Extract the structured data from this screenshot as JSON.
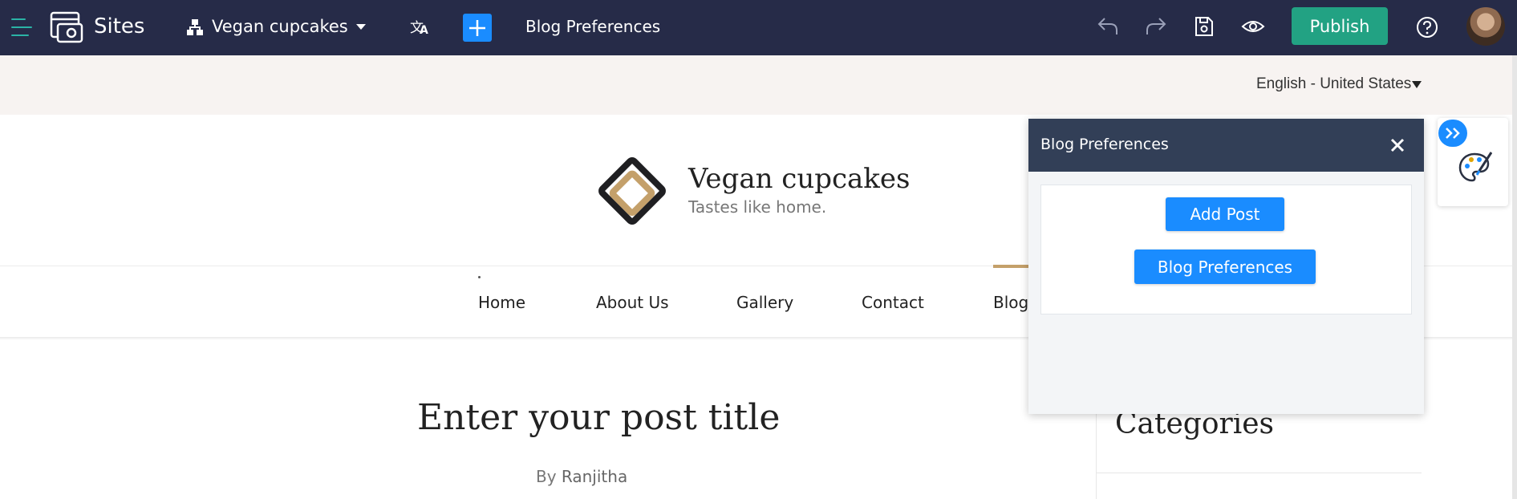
{
  "topbar": {
    "app_name": "Sites",
    "site_name": "Vegan cupcakes",
    "page_name": "Blog Preferences",
    "publish_label": "Publish"
  },
  "language": {
    "selected": "English - United States"
  },
  "site": {
    "title": "Vegan cupcakes",
    "tagline": "Tastes like home."
  },
  "nav": {
    "items": [
      "Home",
      "About Us",
      "Gallery",
      "Contact",
      "Blog"
    ],
    "active": "Blog"
  },
  "post": {
    "title": "Enter your post title",
    "by_label": "By",
    "author": "Ranjitha"
  },
  "sidebar": {
    "categories_title": "Categories"
  },
  "panel": {
    "title": "Blog Preferences",
    "add_post_label": "Add Post",
    "preferences_label": "Blog Preferences"
  },
  "colors": {
    "topbar": "#262b48",
    "publish": "#22a283",
    "accent_blue": "#1a8cff",
    "panel_header": "#323f57",
    "logo_gold": "#c4a06a"
  },
  "icons": [
    "hamburger-icon",
    "sites-icon",
    "sitemap-icon",
    "caret-down-icon",
    "translate-icon",
    "plus-icon",
    "undo-icon",
    "redo-icon",
    "save-icon",
    "preview-eye-icon",
    "help-icon",
    "close-icon",
    "double-chevron-right-icon",
    "palette-icon"
  ]
}
